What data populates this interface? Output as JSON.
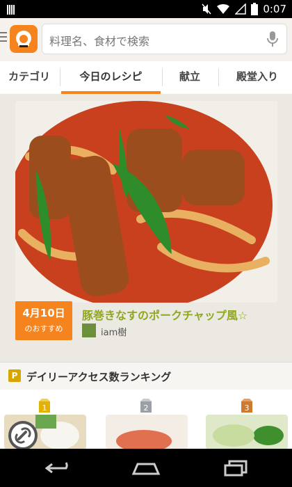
{
  "status": {
    "time": "0:07"
  },
  "search": {
    "placeholder": "料理名、食材で検索"
  },
  "tabs": [
    "カテゴリ",
    "今日のレシピ",
    "献立",
    "殿堂入り"
  ],
  "featured": {
    "date": "4月10日",
    "date_sub": "のおすすめ",
    "title": "豚巻きなすのポークチャップ風☆",
    "author": "iam樹"
  },
  "ranking": {
    "badge": "P",
    "label": "デイリーアクセス数ランキング",
    "medals": [
      "1",
      "2",
      "3"
    ]
  },
  "colors": {
    "accent": "#f5841f",
    "title": "#8fa820"
  }
}
